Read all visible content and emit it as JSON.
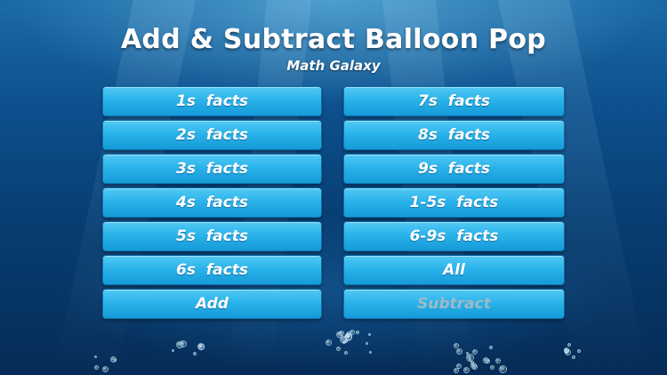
{
  "header": {
    "title": "Add & Subtract Balloon Pop",
    "subtitle": "Math Galaxy"
  },
  "menu": {
    "left": [
      {
        "label": "1s  facts",
        "name": "facts-1s-button"
      },
      {
        "label": "2s  facts",
        "name": "facts-2s-button"
      },
      {
        "label": "3s  facts",
        "name": "facts-3s-button"
      },
      {
        "label": "4s  facts",
        "name": "facts-4s-button"
      },
      {
        "label": "5s  facts",
        "name": "facts-5s-button"
      },
      {
        "label": "6s  facts",
        "name": "facts-6s-button"
      },
      {
        "label": "Add",
        "name": "add-button"
      }
    ],
    "right": [
      {
        "label": "7s  facts",
        "name": "facts-7s-button"
      },
      {
        "label": "8s  facts",
        "name": "facts-8s-button"
      },
      {
        "label": "9s  facts",
        "name": "facts-9s-button"
      },
      {
        "label": "1-5s  facts",
        "name": "facts-1-5s-button"
      },
      {
        "label": "6-9s  facts",
        "name": "facts-6-9s-button"
      },
      {
        "label": "All",
        "name": "all-facts-button"
      },
      {
        "label": "Subtract",
        "name": "subtract-button",
        "disabled": true
      }
    ]
  },
  "colors": {
    "button": "#2ab3ea",
    "button_text": "#ffffff",
    "disabled_text": "#9fb9c6",
    "background": "#0c4f8c"
  }
}
